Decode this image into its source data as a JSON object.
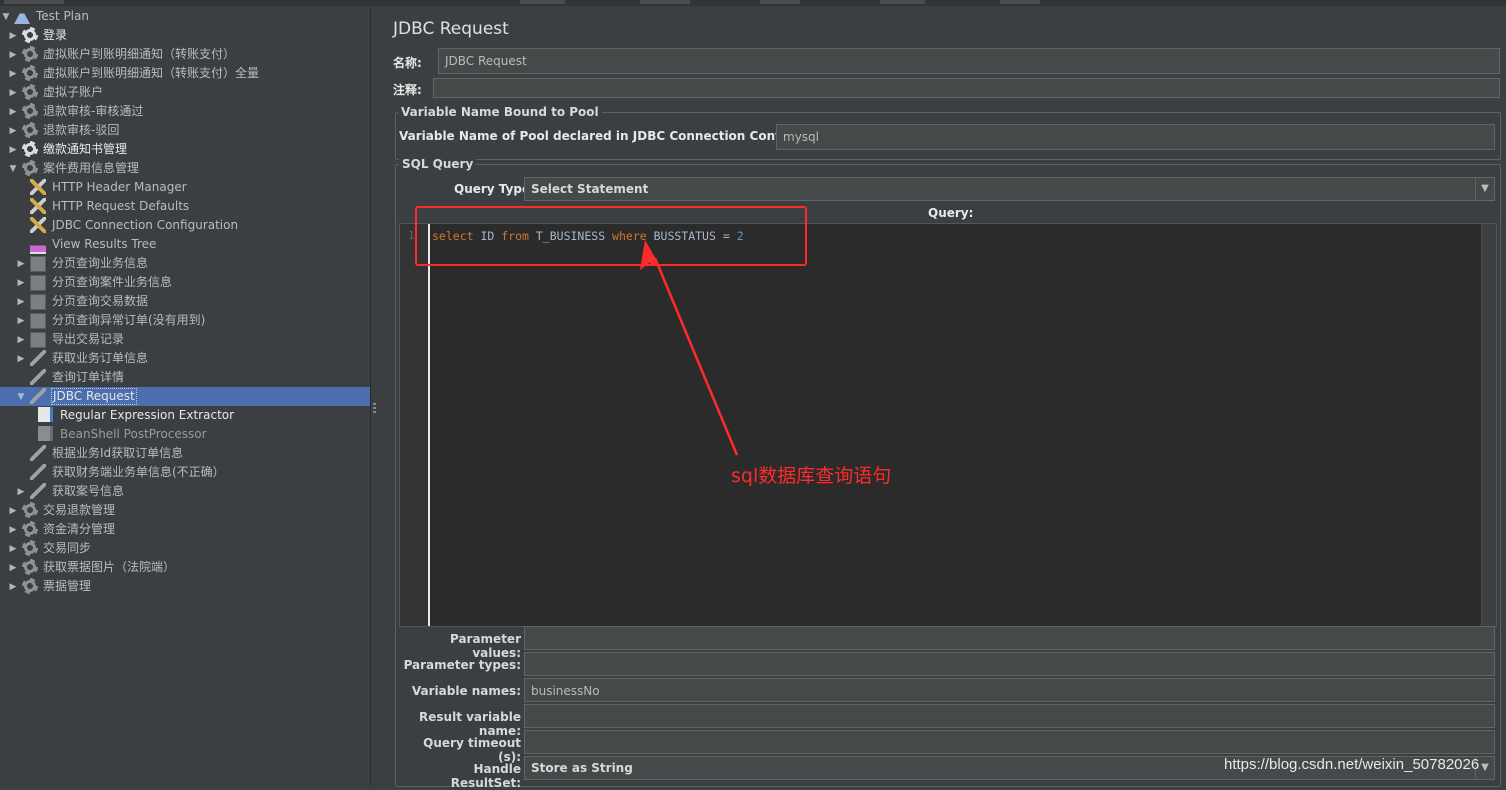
{
  "tree": {
    "items": [
      {
        "label": "Test Plan",
        "expanded": true,
        "icon": "flask-icon"
      },
      {
        "label": "登录",
        "icon": "gear-icon"
      },
      {
        "label": "虚拟账户到账明细通知（转账支付）",
        "icon": "gear-icon"
      },
      {
        "label": "虚拟账户到账明细通知（转账支付）全量",
        "icon": "gear-icon"
      },
      {
        "label": "虚拟子账户",
        "icon": "gear-icon"
      },
      {
        "label": "退款审核-审核通过",
        "icon": "gear-icon"
      },
      {
        "label": "退款审核-驳回",
        "icon": "gear-icon"
      },
      {
        "label": "缴款通知书管理",
        "icon": "gear-icon"
      },
      {
        "label": "案件费用信息管理",
        "expanded": true,
        "icon": "gear-icon"
      },
      {
        "label": "HTTP Header Manager",
        "icon": "tools-icon"
      },
      {
        "label": "HTTP Request Defaults",
        "icon": "tools-icon"
      },
      {
        "label": "JDBC Connection Configuration",
        "icon": "tools-icon"
      },
      {
        "label": "View Results Tree",
        "icon": "chart-icon"
      },
      {
        "label": "分页查询业务信息",
        "icon": "sampler-icon"
      },
      {
        "label": "分页查询案件业务信息",
        "icon": "sampler-icon"
      },
      {
        "label": "分页查询交易数据",
        "icon": "sampler-icon"
      },
      {
        "label": "分页查询异常订单(没有用到)",
        "icon": "sampler-icon"
      },
      {
        "label": "导出交易记录",
        "icon": "sampler-icon"
      },
      {
        "label": "获取业务订单信息",
        "icon": "pen-icon"
      },
      {
        "label": "查询订单详情",
        "icon": "pen-icon"
      },
      {
        "label": "JDBC Request",
        "expanded": true,
        "icon": "pen-icon"
      },
      {
        "label": "Regular Expression Extractor",
        "icon": "doc-icon"
      },
      {
        "label": "BeanShell PostProcessor",
        "icon": "doc-icon"
      },
      {
        "label": "根据业务Id获取订单信息",
        "icon": "pen-icon"
      },
      {
        "label": "获取财务端业务单信息(不正确）",
        "icon": "pen-icon"
      },
      {
        "label": "获取案号信息",
        "icon": "pen-icon"
      },
      {
        "label": "交易退款管理",
        "icon": "gear-icon"
      },
      {
        "label": "资金清分管理",
        "icon": "gear-icon"
      },
      {
        "label": "交易同步",
        "icon": "gear-icon"
      },
      {
        "label": "获取票据图片（法院端）",
        "icon": "gear-icon"
      },
      {
        "label": "票据管理",
        "icon": "gear-icon"
      }
    ]
  },
  "panel": {
    "title": "JDBC Request",
    "name_label": "名称:",
    "name_value": "JDBC Request",
    "comment_label": "注释:",
    "comment_value": "",
    "pool_group": "Variable Name Bound to Pool",
    "pool_label": "Variable Name of Pool declared in JDBC Connection Configuration:",
    "pool_value": "mysql",
    "sql_group": "SQL Query",
    "query_type_label": "Query Type:",
    "query_type_value": "Select Statement",
    "query_label": "Query:",
    "line_number": "1",
    "code": {
      "kw1": "select",
      "t1": " ID ",
      "kw2": "from",
      "t2": " T_BUSINESS ",
      "kw3": "where",
      "t3": " BUSSTATUS = ",
      "n": "2"
    },
    "params": [
      {
        "label": "Parameter values:",
        "value": ""
      },
      {
        "label": "Parameter types:",
        "value": ""
      },
      {
        "label": "Variable names:",
        "value": "businessNo"
      },
      {
        "label": "Result variable name:",
        "value": ""
      },
      {
        "label": "Query timeout (s):",
        "value": ""
      },
      {
        "label": "Handle ResultSet:",
        "value": "Store as String"
      }
    ]
  },
  "annotation": {
    "text": "sql数据库查询语句",
    "color": "#ff2a2a"
  },
  "watermark": "https://blog.csdn.net/weixin_50782026",
  "colors": {
    "background": "#3c3f41",
    "selection": "#4b6eaf",
    "editor": "#2b2b2b",
    "keyword": "#cc7832",
    "number": "#6897bb"
  }
}
